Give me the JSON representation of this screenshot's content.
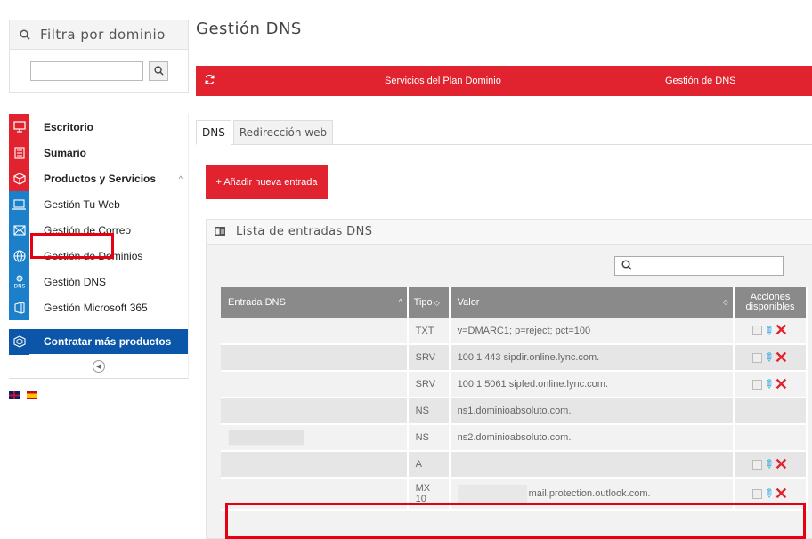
{
  "sidebar": {
    "filter_title": "Filtra por dominio",
    "filter_input_value": "",
    "items": [
      {
        "label": "Escritorio",
        "icon": "monitor-icon",
        "color": "#e1232f",
        "bold": true
      },
      {
        "label": "Sumario",
        "icon": "list-icon",
        "color": "#e1232f",
        "bold": true
      },
      {
        "label": "Productos y Servicios",
        "icon": "cube-icon",
        "color": "#e1232f",
        "bold": true
      },
      {
        "label": "Gestión Tu Web",
        "icon": "laptop-icon",
        "color": "#1c7fc9",
        "bold": false
      },
      {
        "label": "Gestión de Correo",
        "icon": "envelope-icon",
        "color": "#1c7fc9",
        "bold": false
      },
      {
        "label": "Gestión de Dominios",
        "icon": "globe-icon",
        "color": "#1c7fc9",
        "bold": false
      },
      {
        "label": "Gestión DNS",
        "icon": "dns-icon",
        "color": "#1c7fc9",
        "bold": false
      },
      {
        "label": "Gestión Microsoft 365",
        "icon": "office-icon",
        "color": "#1c7fc9",
        "bold": false
      }
    ],
    "contract_label": "Contratar más productos"
  },
  "main": {
    "title": "Gestión DNS",
    "bar": {
      "link1": "Servicios del Plan Dominio",
      "link2": "Gestión de DNS"
    },
    "tabs": [
      {
        "label": "DNS"
      },
      {
        "label": "Redirección web"
      }
    ],
    "add_button": "+ Añadir nueva entrada",
    "panel_title": "Lista de entradas DNS",
    "search_value": "",
    "columns": {
      "entry": "Entrada DNS",
      "type": "Tipo",
      "value": "Valor",
      "actions_1": "Acciones",
      "actions_2": "disponibles"
    },
    "rows": [
      {
        "entry": "",
        "type": "TXT",
        "type2": "",
        "value": "v=DMARC1; p=reject; pct=100",
        "actions": true
      },
      {
        "entry": "",
        "type": "SRV",
        "type2": "",
        "value": "100 1 443 sipdir.online.lync.com.",
        "actions": true
      },
      {
        "entry": "",
        "type": "SRV",
        "type2": "",
        "value": "100 1 5061 sipfed.online.lync.com.",
        "actions": true
      },
      {
        "entry": "",
        "type": "NS",
        "type2": "",
        "value": "ns1.dominioabsoluto.com.",
        "actions": false
      },
      {
        "entry": "",
        "type": "NS",
        "type2": "",
        "value": "ns2.dominioabsoluto.com.",
        "actions": false
      },
      {
        "entry": "",
        "type": "A",
        "type2": "",
        "value": "",
        "actions": true
      },
      {
        "entry": "",
        "type": "MX",
        "type2": "10",
        "value": "mail.protection.outlook.com.",
        "actions": true
      }
    ]
  },
  "colors": {
    "brand_red": "#e1232f",
    "brand_blue": "#1c7fc9",
    "contract_blue": "#0b56a8",
    "highlight": "#e60012"
  }
}
